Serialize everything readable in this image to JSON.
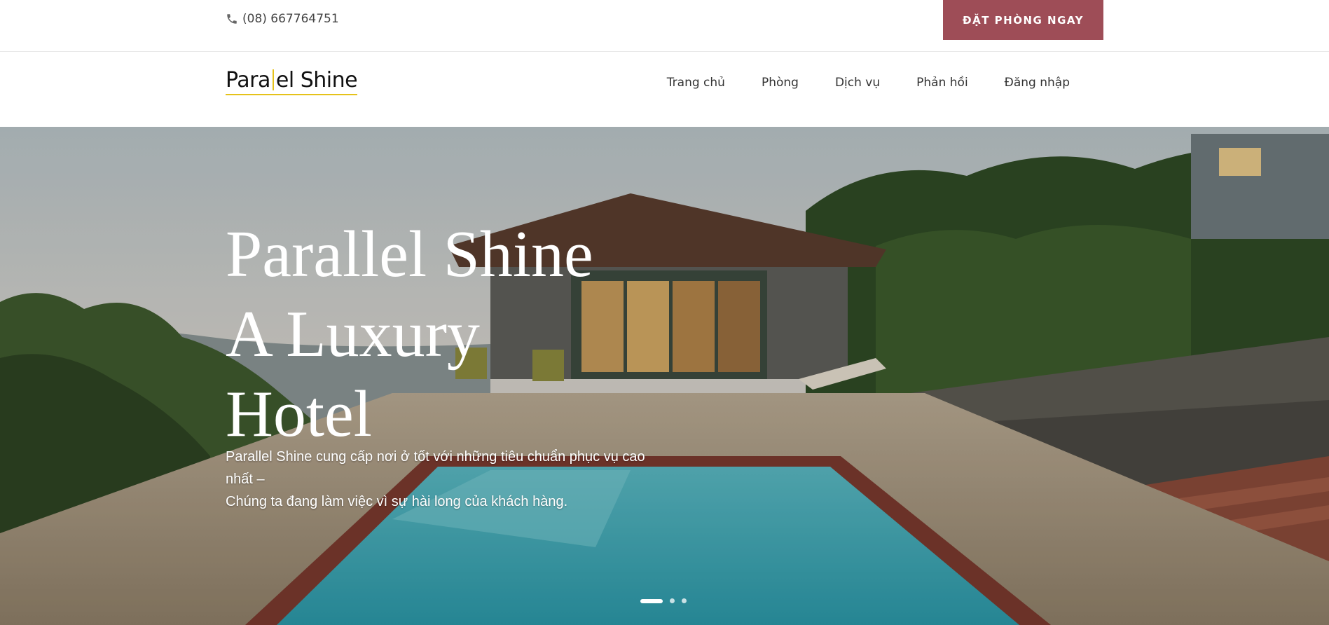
{
  "topbar": {
    "phone": "(08) 667764751",
    "phone_icon": "phone-icon",
    "book_button": "ĐẶT PHÒNG NGAY",
    "book_button_color": "#9e4d57"
  },
  "header": {
    "logo_left": "Para",
    "logo_right": "el Shine",
    "logo_accent_color": "#e5c21a",
    "nav": [
      {
        "label": "Trang chủ"
      },
      {
        "label": "Phòng"
      },
      {
        "label": "Dịch vụ"
      },
      {
        "label": "Phản hồi"
      },
      {
        "label": "Đăng nhập"
      }
    ]
  },
  "hero": {
    "title_line1": "Parallel Shine",
    "title_line2": "A Luxury",
    "title_line3": "Hotel",
    "desc_line1": "Parallel Shine cung cấp nơi ở tốt với những tiêu chuẩn phục vụ cao nhất –",
    "desc_line2": "Chúng ta đang làm việc vì sự hài long của khách hàng.",
    "slides_count": 3,
    "active_slide": 1
  }
}
